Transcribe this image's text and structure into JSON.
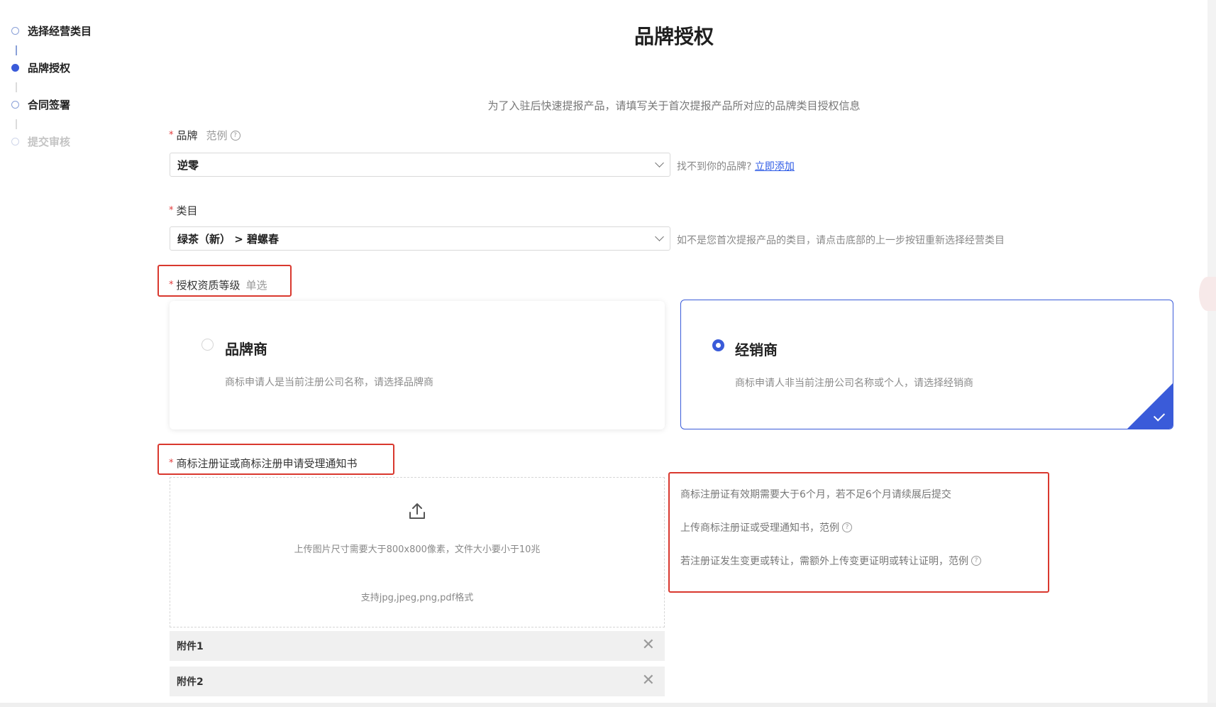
{
  "steps": [
    {
      "label": "选择经营类目",
      "state": "done"
    },
    {
      "label": "品牌授权",
      "state": "active"
    },
    {
      "label": "合同签署",
      "state": "pending"
    },
    {
      "label": "提交审核",
      "state": "disabled"
    }
  ],
  "page_title": "品牌授权",
  "intro": "为了入驻后快速提报产品，请填写关于首次提报产品所对应的品牌类目授权信息",
  "brand": {
    "label": "品牌",
    "example": "范例",
    "value": "逆零",
    "hint": "找不到你的品牌?",
    "add_link": "立即添加"
  },
  "category": {
    "label": "类目",
    "value": "绿茶（新） > 碧螺春",
    "hint": "如不是您首次提报产品的类目，请点击底部的上一步按钮重新选择经营类目"
  },
  "qualification": {
    "label": "授权资质等级",
    "note": "单选",
    "options": [
      {
        "title": "品牌商",
        "desc": "商标申请人是当前注册公司名称，请选择品牌商",
        "selected": false
      },
      {
        "title": "经销商",
        "desc": "商标申请人非当前注册公司名称或个人，请选择经销商",
        "selected": true
      }
    ]
  },
  "trademark": {
    "label": "商标注册证或商标注册申请受理通知书",
    "upload_size": "上传图片尺寸需要大于800x800像素，文件大小要小于10兆",
    "upload_formats": "支持jpg,jpeg,png,pdf格式",
    "attachments": [
      "附件1",
      "附件2"
    ],
    "rules": [
      "商标注册证有效期需要大于6个月，若不足6个月请续展后提交",
      "上传商标注册证或受理通知书，范例",
      "若注册证发生变更或转让，需额外上传变更证明或转让证明，范例"
    ]
  },
  "colors": {
    "accent": "#3a5bd9",
    "highlight_box": "#d9382e",
    "required": "#e23a3a",
    "link": "#2c5ae6"
  },
  "icons": [
    "upload-icon",
    "close-icon",
    "help-icon",
    "chevron-down-icon",
    "check-icon"
  ]
}
